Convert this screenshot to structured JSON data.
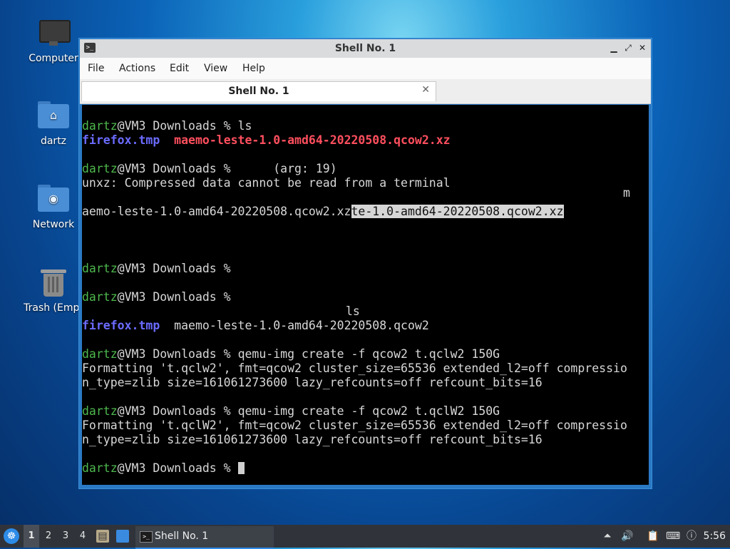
{
  "desktop": {
    "icons": [
      {
        "label": "Computer",
        "icon": "computer-icon"
      },
      {
        "label": "dartz",
        "icon": "home-folder-icon"
      },
      {
        "label": "Network",
        "icon": "network-folder-icon"
      },
      {
        "label": "Trash (Empt",
        "icon": "trash-icon"
      }
    ]
  },
  "window": {
    "title": "Shell No. 1",
    "controls": {
      "minimize": "▁",
      "maximize": "⤢",
      "close": "✕"
    },
    "menu": [
      "File",
      "Actions",
      "Edit",
      "View",
      "Help"
    ],
    "tab": {
      "label": "Shell No. 1",
      "close": "✕"
    }
  },
  "terminal": {
    "prompt_user": "dartz",
    "prompt_rest": "@VM3 Downloads % ",
    "lines": {
      "l1_cmd": "ls",
      "l2_blue": "firefox.tmp",
      "l2_red": "maemo-leste-1.0-amd64-20220508.qcow2.xz",
      "l4_rest": "     (arg: 19)",
      "l5": "unxz: Compressed data cannot be read from a terminal",
      "l6": "m",
      "l7_plain": "aemo-leste-1.0-amd64-20220508.qcow2.xz",
      "l7_sel": "te-1.0-amd64-20220508.qcow2.xz",
      "l14": "ls",
      "l15_blue": "firefox.tmp",
      "l15_rest": "maemo-leste-1.0-amd64-20220508.qcow2",
      "l17_cmd": "qemu-img create -f qcow2 t.qclw2 150G",
      "l18": "Formatting 't.qclw2', fmt=qcow2 cluster_size=65536 extended_l2=off compressio",
      "l19": "n_type=zlib size=161061273600 lazy_refcounts=off refcount_bits=16",
      "l21_cmd": "qemu-img create -f qcow2 t.qclW2 150G",
      "l22": "Formatting 't.qclW2', fmt=qcow2 cluster_size=65536 extended_l2=off compressio",
      "l23": "n_type=zlib size=161061273600 lazy_refcounts=off refcount_bits=16"
    }
  },
  "taskbar": {
    "workspaces": [
      "1",
      "2",
      "3",
      "4"
    ],
    "active_workspace": "1",
    "task_label": "Shell No. 1",
    "clock": "5:56"
  }
}
